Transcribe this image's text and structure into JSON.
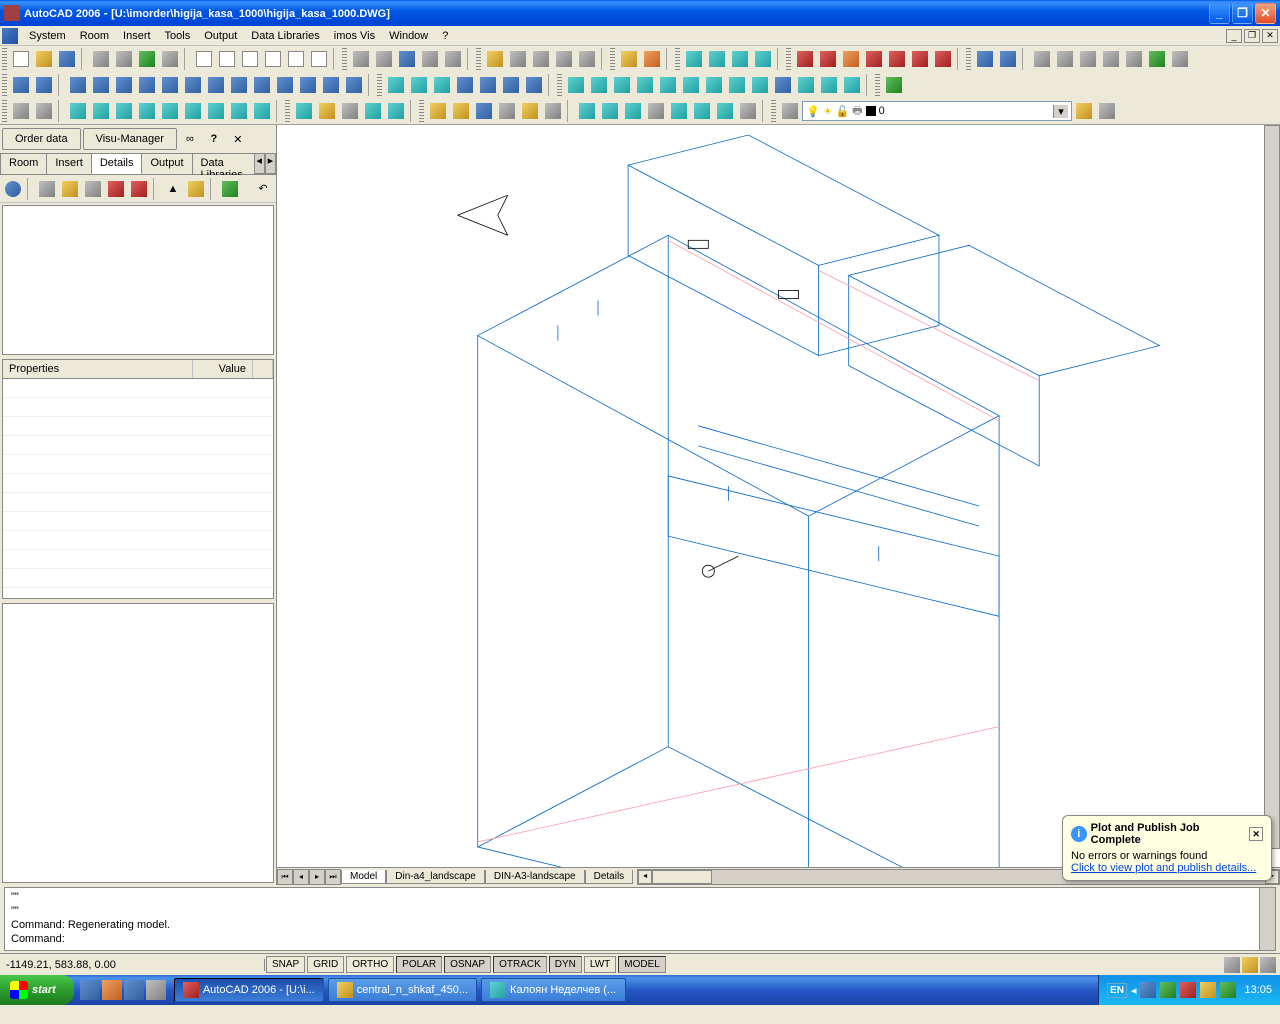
{
  "titlebar": {
    "app": "AutoCAD 2006",
    "doc": "[U:\\imorder\\higija_kasa_1000\\higija_kasa_1000.DWG]"
  },
  "menu": {
    "items": [
      "System",
      "Room",
      "Insert",
      "Tools",
      "Output",
      "Data Libraries",
      "imos Vis",
      "Window",
      "?"
    ]
  },
  "layer": {
    "name": "0"
  },
  "left_panel": {
    "buttons": {
      "order": "Order data",
      "visu": "Visu-Manager"
    },
    "tabs": [
      "Room",
      "Insert",
      "Details",
      "Output",
      "Data Libraries"
    ],
    "active_tab": 2,
    "props": {
      "col1": "Properties",
      "col2": "Value"
    }
  },
  "layout_tabs": [
    "Model",
    "Din-a4_landscape",
    "DIN-A3-landscape",
    "Details"
  ],
  "command": {
    "lines": "\"\"\n\"\"\nCommand: Regenerating model.\nCommand:"
  },
  "status": {
    "coords": "-1149.21, 583.88, 0.00",
    "toggles": [
      "SNAP",
      "GRID",
      "ORTHO",
      "POLAR",
      "OSNAP",
      "OTRACK",
      "DYN",
      "LWT",
      "MODEL"
    ]
  },
  "balloon": {
    "title": "Plot and Publish Job Complete",
    "msg": "No errors or warnings found",
    "link": "Click to view plot and publish details..."
  },
  "taskbar": {
    "start": "start",
    "tasks": [
      {
        "label": "AutoCAD 2006 - [U:\\i...",
        "active": true
      },
      {
        "label": "central_n_shkaf_450...",
        "active": false
      },
      {
        "label": "Калоян Неделчев (...",
        "active": false
      }
    ],
    "lang": "EN",
    "clock": "13:05"
  }
}
